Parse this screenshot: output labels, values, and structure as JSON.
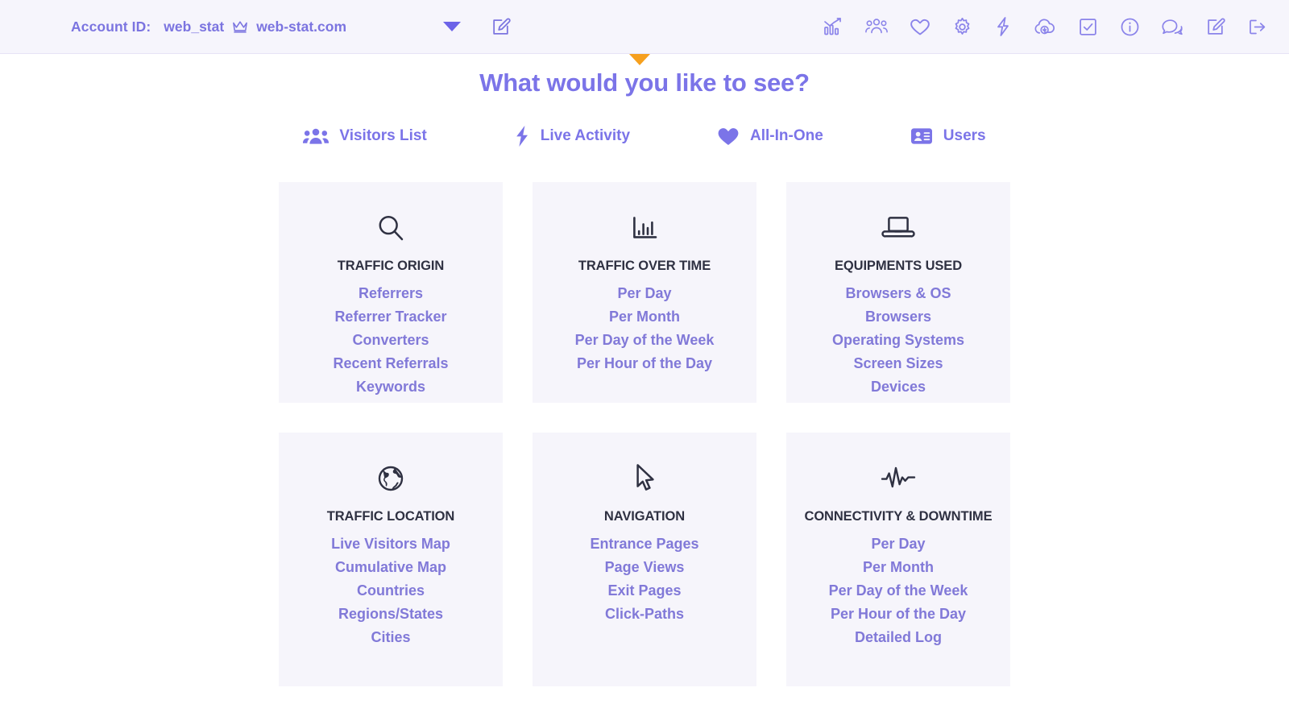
{
  "header": {
    "account_label": "Account ID:",
    "account_id": "web_stat",
    "crown_icon": "crown-icon",
    "account_domain": "web-stat.com",
    "dropdown_icon": "chevron-down-icon",
    "edit_icon": "edit-square-icon",
    "icons": [
      {
        "name": "analytics-chart-icon",
        "title": "Statistics"
      },
      {
        "name": "visitors-group-icon",
        "title": "Visitors"
      },
      {
        "name": "heart-icon",
        "title": "All-In-One"
      },
      {
        "name": "gear-icon",
        "title": "Settings"
      },
      {
        "name": "lightning-bolt-icon",
        "title": "Live Activity"
      },
      {
        "name": "cloud-download-icon",
        "title": "Download"
      },
      {
        "name": "checkbox-checked-icon",
        "title": "Tasks"
      },
      {
        "name": "info-circle-icon",
        "title": "Info"
      },
      {
        "name": "chat-bubbles-icon",
        "title": "Support"
      },
      {
        "name": "edit-square-icon",
        "title": "Edit"
      },
      {
        "name": "logout-icon",
        "title": "Log Out"
      }
    ]
  },
  "main": {
    "heading": "What would you like to see?",
    "caret_color": "#f6a01e",
    "accent_color": "#7b74e8",
    "tabs": [
      {
        "label": "Visitors List",
        "icon": "visitors-group-icon"
      },
      {
        "label": "Live Activity",
        "icon": "lightning-bolt-icon"
      },
      {
        "label": "All-In-One",
        "icon": "heart-icon"
      },
      {
        "label": "Users",
        "icon": "id-card-icon"
      }
    ],
    "cards": [
      {
        "title": "TRAFFIC ORIGIN",
        "icon": "search-icon",
        "links": [
          "Referrers",
          "Referrer Tracker",
          "Converters",
          "Recent Referrals",
          "Keywords"
        ]
      },
      {
        "title": "TRAFFIC OVER TIME",
        "icon": "bar-chart-icon",
        "links": [
          "Per Day",
          "Per Month",
          "Per Day of the Week",
          "Per Hour of the Day"
        ]
      },
      {
        "title": "EQUIPMENTS USED",
        "icon": "laptop-icon",
        "links": [
          "Browsers & OS",
          "Browsers",
          "Operating Systems",
          "Screen Sizes",
          "Devices"
        ]
      },
      {
        "title": "TRAFFIC LOCATION",
        "icon": "globe-icon",
        "links": [
          "Live Visitors Map",
          "Cumulative Map",
          "Countries",
          "Regions/States",
          "Cities"
        ]
      },
      {
        "title": "NAVIGATION",
        "icon": "cursor-pointer-icon",
        "links": [
          "Entrance Pages",
          "Page Views",
          "Exit Pages",
          "Click-Paths"
        ]
      },
      {
        "title": "CONNECTIVITY & DOWNTIME",
        "icon": "pulse-line-icon",
        "links": [
          "Per Day",
          "Per Month",
          "Per Day of the Week",
          "Per Hour of the Day",
          "Detailed Log"
        ]
      }
    ]
  }
}
